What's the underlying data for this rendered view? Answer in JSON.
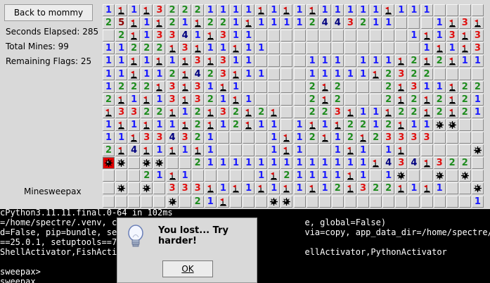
{
  "sidebar": {
    "back_label": "Back to mommy",
    "seconds": "Seconds Elapsed: 285",
    "mines": "Total Mines: 99",
    "flags": "Remaining Flags: 25",
    "title": "Minesweepax"
  },
  "board": {
    "legend": "0-8=revealed count (0 blank), .=unrevealed, F=flag, M=mine, X=exploded mine, W=wrong flag",
    "rows": [
      "1F1F32221111F1F1F11111F111....2F311",
      "25F1F21F221F11112443211...1F3F1F1F1",
      ".2F13341F311............1F13F322...",
      "11222F3F11F11............1F1F322...",
      "11F1F1F3F311....111.111F2F2F1111F1.",
      "11F112F423F11...11111F2322.........",
      "1222F3F31F1.....2F2...2F311F22211..",
      "2F1F13F321F1....2F2...2F2F2F21F3F1F11",
      "F3322F12F32F2F..223F11F22F2F2155M.M",
      "1F1F11F2F12F11.1F1F2212F11MM.....M",
      "11F334321....1F12F12F23333.....M...",
      "2F4F1F1F1....1F1..1F1.1F.....M.M.MM",
      "XM MM .21111111111111F434F322.M.....",
      "...21F1.....1F21111F1.1M..M.M......",
      ".M.M.333F1F1F1F1F12F322F1F1..M....M",
      ".....M.21F...MM..............112F1M"
    ]
  },
  "terminal": {
    "lines": [
      "cPython3.11.11.final.0-64 in 102ms",
      "=/home/spectre/.venv, cl                                    e, global=False)",
      "d=False, pip=bundle, set                                    via=copy, app_data_dir=/home/spectre/.local/sh",
      "==25.0.1, setuptools==75",
      "ShellActivator,FishActiv                                    ellActivator,PythonActivator",
      "",
      "sweepax>",
      "sweepax"
    ]
  },
  "dialog": {
    "message": "You lost... Try harder!",
    "icon": "lightbulb-icon",
    "ok_label": "OK"
  },
  "colors": {
    "1": "#1a1aff",
    "2": "#1e8c1e",
    "3": "#e01010",
    "4": "#000080",
    "5": "#8b0000",
    "6": "#008080",
    "7": "#000000",
    "8": "#808080",
    "flag": "#e00000",
    "exploded": "#e00000"
  }
}
